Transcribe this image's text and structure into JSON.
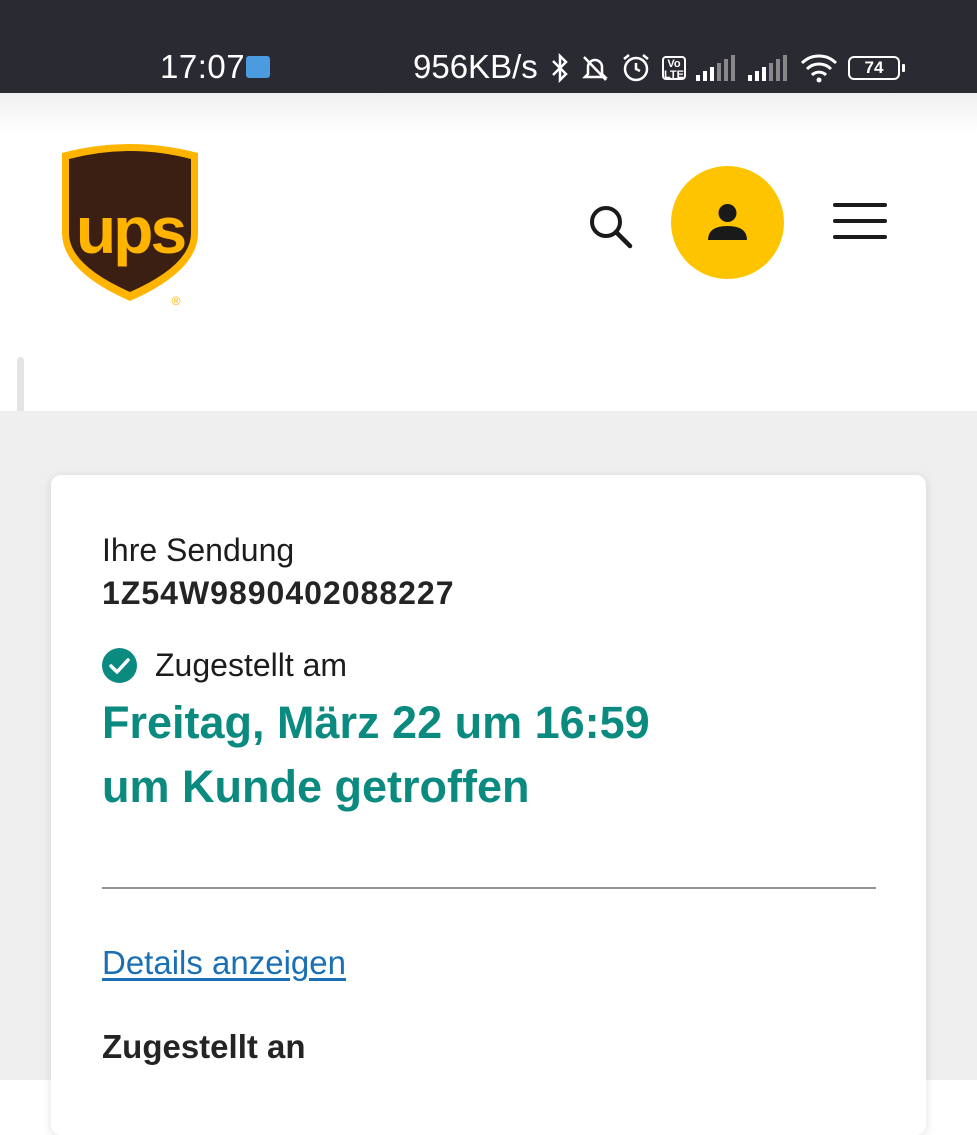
{
  "status_bar": {
    "time": "17:07",
    "network_speed": "956KB/s",
    "battery": "74",
    "icons": [
      "mail-icon",
      "bluetooth-icon",
      "bell-muted-icon",
      "alarm-icon",
      "volte-icon",
      "signal-icon",
      "wifi-icon",
      "battery-icon"
    ],
    "volte_label": "Vo LTE"
  },
  "header": {
    "logo_text": "ups",
    "logo_mark": "®",
    "brand_colors": {
      "shield": "#3b1f12",
      "gold": "#ffb500",
      "account": "#ffc400"
    },
    "icons": [
      "search-icon",
      "user-icon",
      "menu-icon"
    ]
  },
  "shipment": {
    "label": "Ihre Sendung",
    "tracking_number": "1Z54W9890402088227",
    "status_label": "Zugestellt am",
    "delivery_date": "Freitag, März 22 um 16:59",
    "delivery_note": "um Kunde getroffen",
    "details_link": "Details anzeigen",
    "delivered_to_label": "Zugestellt an",
    "status_color": "#0b8a80"
  }
}
